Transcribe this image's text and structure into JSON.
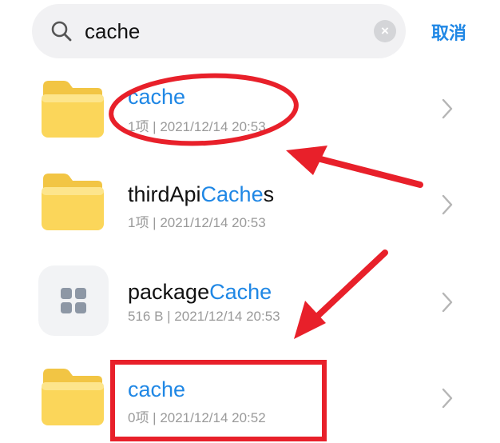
{
  "search": {
    "query": "cache",
    "cancel_label": "取消",
    "clear_symbol": "×"
  },
  "items": [
    {
      "name_plain": "",
      "name_highlight": "cache",
      "name_suffix": "",
      "meta": "1项  |  2021/12/14 20:53",
      "icon": "folder-icon"
    },
    {
      "name_plain": "thirdApi",
      "name_highlight": "Cache",
      "name_suffix": "s",
      "meta": "1项  |  2021/12/14 20:53",
      "icon": "folder-icon"
    },
    {
      "name_plain": "package",
      "name_highlight": "Cache",
      "name_suffix": "",
      "meta": "516 B  |  2021/12/14 20:53",
      "icon": "app-grid-icon"
    },
    {
      "name_plain": "",
      "name_highlight": "cache",
      "name_suffix": "",
      "meta": "0项  |  2021/12/14 20:52",
      "icon": "folder-icon"
    }
  ],
  "colors": {
    "accent": "#1f87e5",
    "annotation": "#e8202a",
    "folder": "#fbd65a"
  }
}
